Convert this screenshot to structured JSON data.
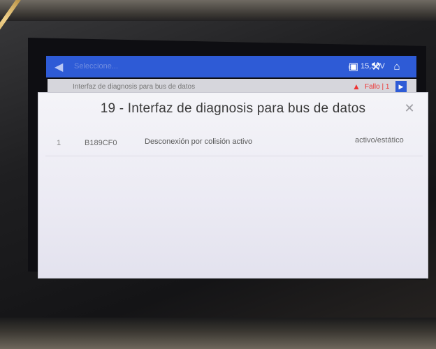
{
  "app": {
    "header_title": "Seleccione...",
    "back_icon": "back-arrow-icon",
    "voltage": "15,30V",
    "voltage_icon": "battery-icon",
    "buttons": [
      {
        "name": "report-icon",
        "glyph": "▣"
      },
      {
        "name": "car-tool-icon",
        "glyph": "⚒"
      },
      {
        "name": "home-icon",
        "glyph": "⌂"
      }
    ]
  },
  "subheader": {
    "title": "Interfaz de diagnosis para bus de datos",
    "fault_label": "Fallo | 1",
    "warning_icon": "warning-icon",
    "play_icon": "play-icon"
  },
  "modal": {
    "title": "19 - Interfaz de diagnosis para bus de datos",
    "close_icon": "close-icon",
    "rows": [
      {
        "index": "1",
        "code": "B189CF0",
        "description": "Desconexión por colisión activo",
        "status": "activo/estático"
      }
    ]
  },
  "colors": {
    "header_blue": "#2e5bd6",
    "fault_red": "#e33333",
    "modal_bg": "#f1f1f6"
  }
}
